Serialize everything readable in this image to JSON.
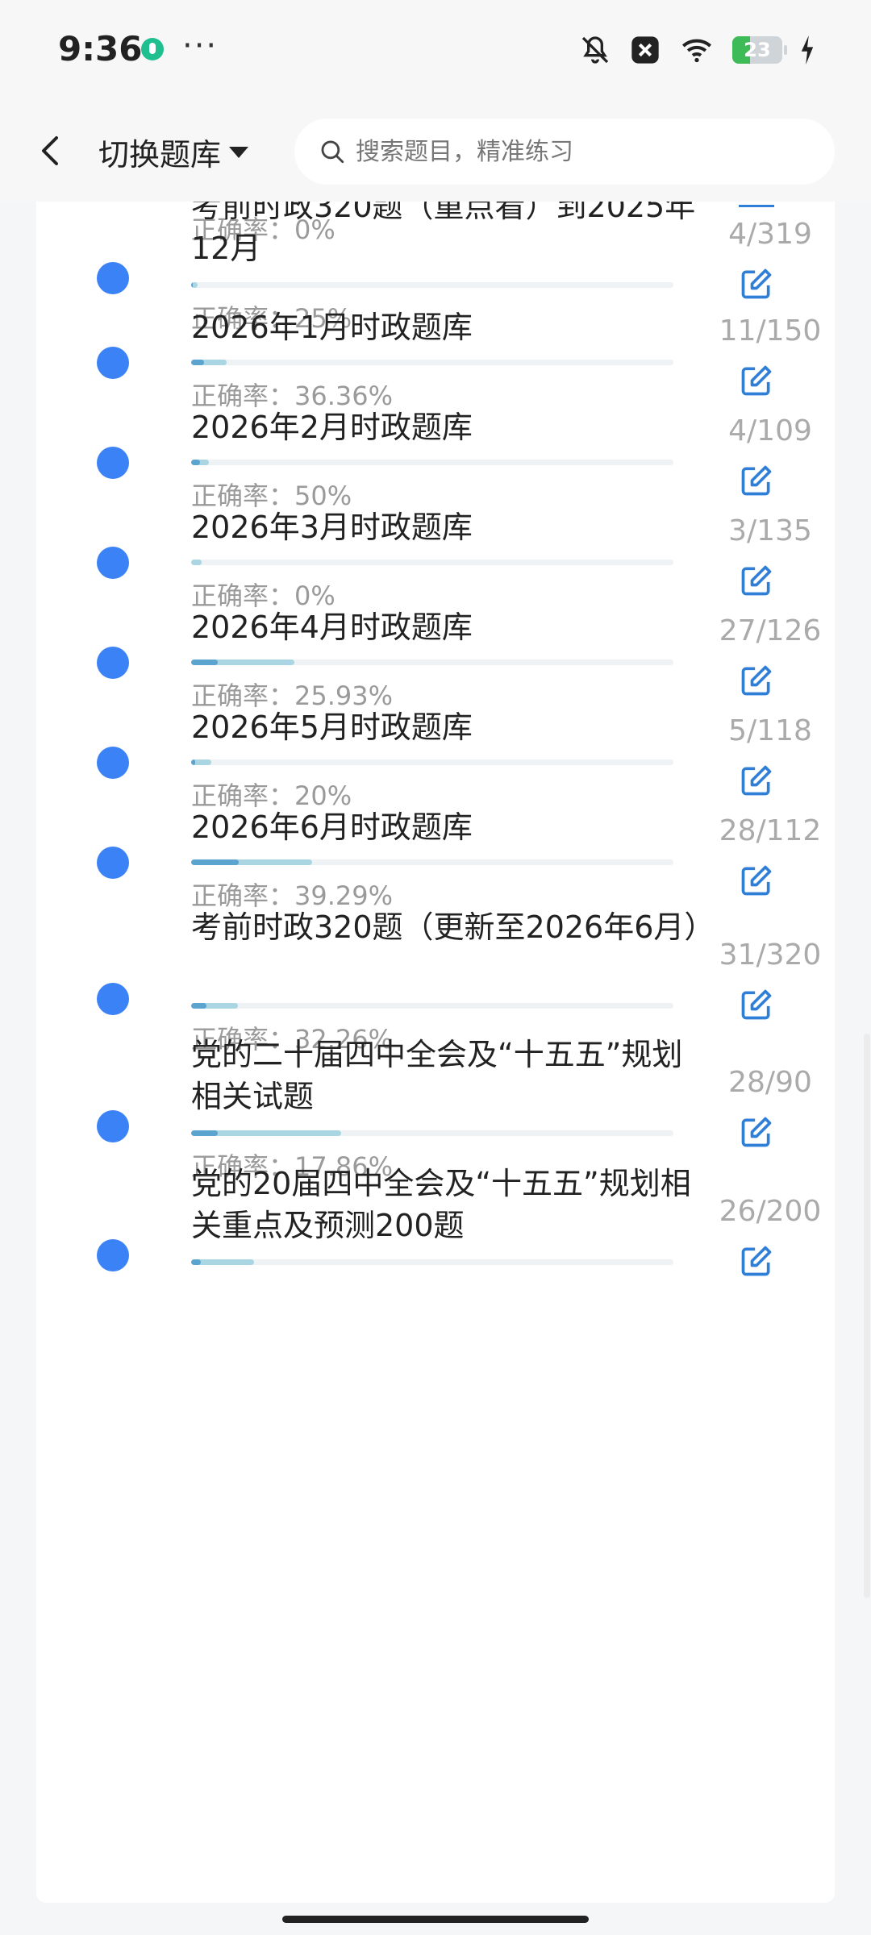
{
  "status_bar": {
    "time": "9:36",
    "dots": "···",
    "battery": "23",
    "icons": [
      "app-leaf-icon",
      "bell-muted-icon",
      "close-box-icon",
      "wifi-icon",
      "battery-icon",
      "charging-icon"
    ]
  },
  "header": {
    "title": "切换题库",
    "search_placeholder": "搜索题目，精准练习"
  },
  "partial_top": {
    "accuracy": "正确率：0%"
  },
  "items": [
    {
      "title": "考前时政320题（重点看）到2025年12月",
      "accuracy": "正确率：25%",
      "count": "4/319",
      "done_fraction": 0.013,
      "correct_fraction": 0.003
    },
    {
      "title": "2026年1月时政题库",
      "accuracy": "正确率：36.36%",
      "count": "11/150",
      "done_fraction": 0.073,
      "correct_fraction": 0.027
    },
    {
      "title": "2026年2月时政题库",
      "accuracy": "正确率：50%",
      "count": "4/109",
      "done_fraction": 0.037,
      "correct_fraction": 0.018
    },
    {
      "title": "2026年3月时政题库",
      "accuracy": "正确率：0%",
      "count": "3/135",
      "done_fraction": 0.022,
      "correct_fraction": 0.0
    },
    {
      "title": "2026年4月时政题库",
      "accuracy": "正确率：25.93%",
      "count": "27/126",
      "done_fraction": 0.214,
      "correct_fraction": 0.056
    },
    {
      "title": "2026年5月时政题库",
      "accuracy": "正确率：20%",
      "count": "5/118",
      "done_fraction": 0.042,
      "correct_fraction": 0.008
    },
    {
      "title": "2026年6月时政题库",
      "accuracy": "正确率：39.29%",
      "count": "28/112",
      "done_fraction": 0.25,
      "correct_fraction": 0.098
    },
    {
      "title": "考前时政320题（更新至2026年6月）",
      "accuracy": "正确率：32.26%",
      "count": "31/320",
      "done_fraction": 0.097,
      "correct_fraction": 0.031
    },
    {
      "title": "党的二十届四中全会及“十五五”规划相关试题",
      "accuracy": "正确率：17.86%",
      "count": "28/90",
      "done_fraction": 0.311,
      "correct_fraction": 0.056
    },
    {
      "title": "党的20届四中全会及“十五五”规划相关重点及预测200题",
      "accuracy": "",
      "count": "26/200",
      "done_fraction": 0.13,
      "correct_fraction": 0.02
    }
  ],
  "colors": {
    "dot": "#3b82f6",
    "progress_done": "#a9d6e2",
    "progress_correct": "#5ba4cf",
    "edit_icon": "#2f7fd8"
  }
}
